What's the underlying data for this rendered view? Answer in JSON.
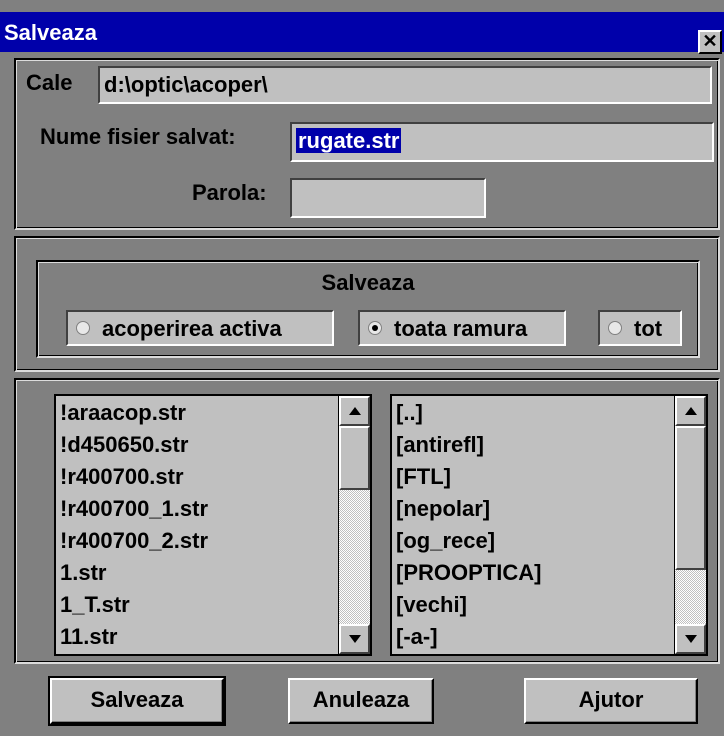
{
  "window": {
    "title": "Salveaza",
    "close_label": "✕"
  },
  "path": {
    "label": "Cale",
    "value": "d:\\optic\\acoper\\"
  },
  "filename": {
    "label": "Nume fisier salvat:",
    "value": "rugate.str"
  },
  "password": {
    "label": "Parola:",
    "value": ""
  },
  "save_group": {
    "title": "Salveaza",
    "options": [
      {
        "label": "acoperirea activa",
        "selected": false
      },
      {
        "label": "toata ramura",
        "selected": true
      },
      {
        "label": "tot",
        "selected": false
      }
    ]
  },
  "files": [
    "!araacop.str",
    "!d450650.str",
    "!r400700.str",
    "!r400700_1.str",
    "!r400700_2.str",
    "1.str",
    "1_T.str",
    "11.str"
  ],
  "dirs": [
    "[..]",
    "[antirefl]",
    "[FTL]",
    "[nepolar]",
    "[og_rece]",
    "[PROOPTICA]",
    "[vechi]",
    "[-a-]"
  ],
  "buttons": {
    "save": "Salveaza",
    "cancel": "Anuleaza",
    "help": "Ajutor"
  },
  "colors": {
    "title_bg": "#0000aa",
    "dialog_bg": "#808080",
    "field_bg": "#c0c0c0",
    "selection_bg": "#0000aa"
  }
}
